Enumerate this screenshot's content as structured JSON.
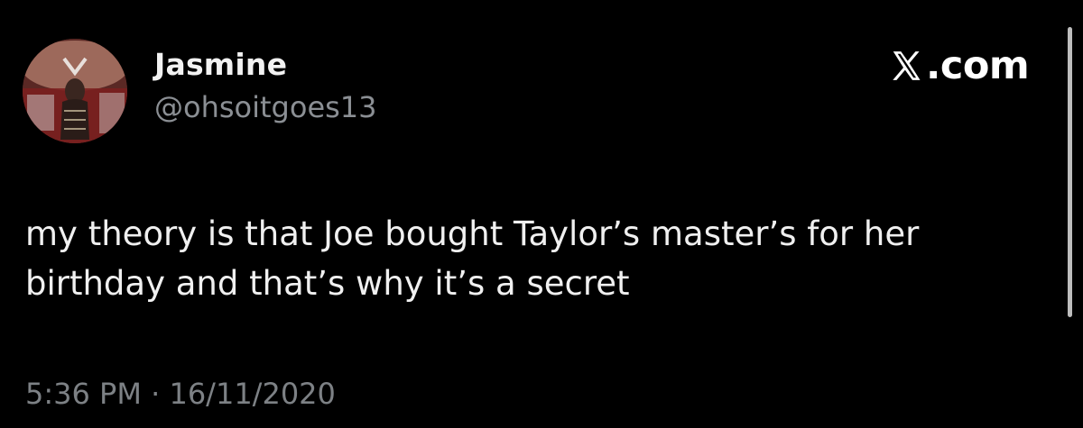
{
  "tweet": {
    "display_name": "Jasmine",
    "handle": "@ohsoitgoes13",
    "site_logo_text": ".com",
    "site_logo_icon": "x-logo-icon",
    "text": "my theory is that Joe bought Taylor’s master’s for her\nbirthday and that’s why it’s a secret",
    "time": "5:36 PM",
    "separator": "·",
    "date": "16/11/2020",
    "avatar_icon": "profile-photo"
  },
  "colors": {
    "background": "#000000",
    "primary_text": "#f0f0f0",
    "secondary_text": "#8b8f94",
    "scrollbar": "#bdbdbd"
  }
}
